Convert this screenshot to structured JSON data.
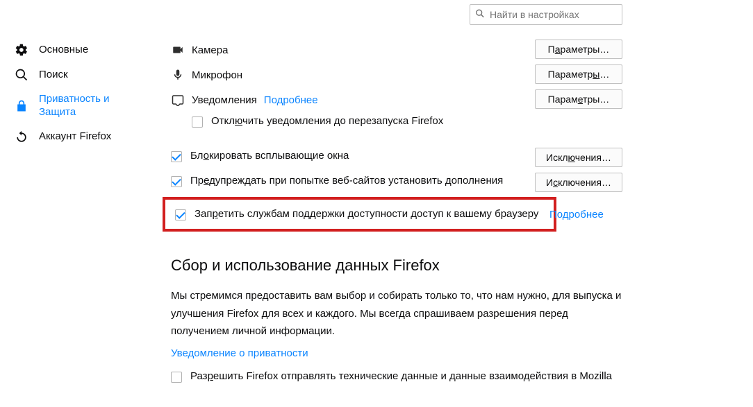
{
  "search": {
    "placeholder": "Найти в настройках"
  },
  "sidebar": {
    "items": [
      {
        "label": "Основные"
      },
      {
        "label": "Поиск"
      },
      {
        "label": "Приватность и Защита"
      },
      {
        "label": "Аккаунт Firefox"
      }
    ]
  },
  "permissions": {
    "camera": {
      "label": "Камера",
      "button_pre": "П",
      "button_u": "а",
      "button_post": "раметры…"
    },
    "microphone": {
      "label": "Микрофон",
      "button_pre": "Параметр",
      "button_u": "ы",
      "button_post": "…"
    },
    "notifications": {
      "label": "Уведомления",
      "more": "Подробнее",
      "button_pre": "Парам",
      "button_u": "е",
      "button_post": "тры…"
    },
    "disable_until_restart": {
      "pre": "Откл",
      "u": "ю",
      "post": "чить уведомления до перезапуска Firefox"
    }
  },
  "popups": {
    "block": {
      "pre": "Бл",
      "u": "о",
      "post": "кировать всплывающие окна",
      "button_pre": "Искл",
      "button_u": "ю",
      "button_post": "чения…"
    },
    "warn_addons": {
      "pre": "Пр",
      "u": "е",
      "post": "дупреждать при попытке веб-сайтов установить дополнения",
      "button_pre": "И",
      "button_u": "с",
      "button_post": "ключения…"
    },
    "accessibility": {
      "pre": "Зап",
      "u": "р",
      "post": "етить службам поддержки доступности доступ к вашему браузеру",
      "more": "Подробнее"
    }
  },
  "data_section": {
    "title": "Сбор и использование данных Firefox",
    "text": "Мы стремимся предоставить вам выбор и собирать только то, что нам нужно, для выпуска и улучшения Firefox для всех и каждого. Мы всегда спрашиваем разрешения перед получением личной информации.",
    "privacy_link": "Уведомление о приватности",
    "telemetry": {
      "pre": "Раз",
      "u": "р",
      "post": "ешить Firefox отправлять технические данные и данные взаимодействия в Mozilla"
    }
  }
}
